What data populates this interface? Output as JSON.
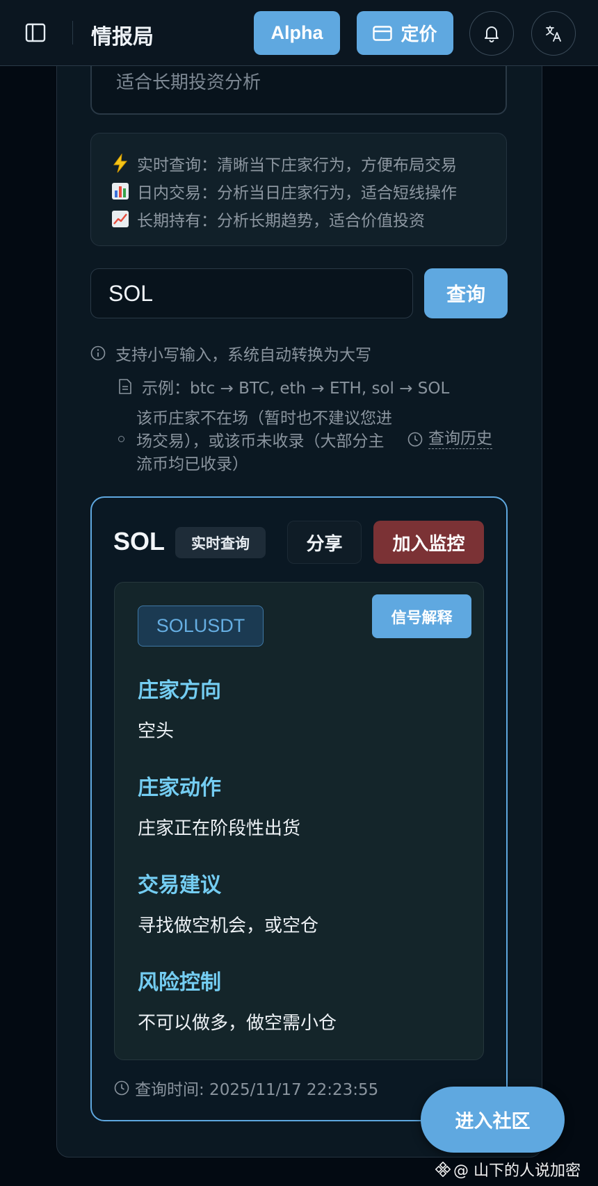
{
  "header": {
    "title": "情报局",
    "alpha_label": "Alpha",
    "pricing_label": "定价"
  },
  "previous_option": {
    "text": "适合长期投资分析"
  },
  "modes": [
    {
      "icon": "lightning-emoji",
      "text": "实时查询：清晰当下庄家行为，方便布局交易"
    },
    {
      "icon": "bar-chart-emoji",
      "text": "日内交易：分析当日庄家行为，适合短线操作"
    },
    {
      "icon": "trend-up-emoji",
      "text": "长期持有：分析长期趋势，适合价值投资"
    }
  ],
  "search": {
    "value": "SOL",
    "button_label": "查询"
  },
  "hints": {
    "lowercase": "支持小写输入，系统自动转换为大写",
    "example": "示例：btc → BTC, eth → ETH, sol → SOL",
    "not_listed": "该币庄家不在场（暂时也不建议您进场交易），或该币未收录（大部分主流币均已收录）",
    "history_link": "查询历史"
  },
  "result": {
    "symbol": "SOL",
    "mode_tag": "实时查询",
    "share_label": "分享",
    "monitor_label": "加入监控",
    "pair": "SOLUSDT",
    "explain_label": "信号解释",
    "sections": [
      {
        "title": "庄家方向",
        "value": "空头"
      },
      {
        "title": "庄家动作",
        "value": "庄家正在阶段性出货"
      },
      {
        "title": "交易建议",
        "value": "寻找做空机会，或空仓"
      },
      {
        "title": "风险控制",
        "value": "不可以做多，做空需小仓"
      }
    ],
    "query_time": "查询时间: 2025/11/17 22:23:55"
  },
  "community_label": "进入社区",
  "watermark": "@ 山下的人说加密",
  "colors": {
    "accent": "#5fa8e0",
    "section_title": "#74cdf2",
    "monitor_button": "#7b3235",
    "background": "#030a12"
  }
}
